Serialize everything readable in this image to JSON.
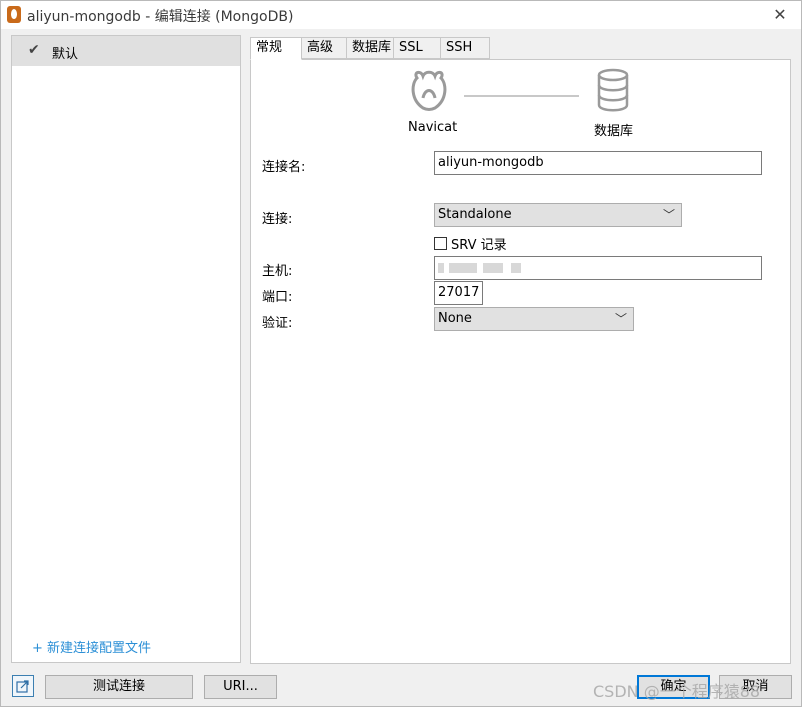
{
  "window": {
    "title": "aliyun-mongodb - 编辑连接 (MongoDB)"
  },
  "profiles": {
    "items": [
      {
        "label": "默认",
        "selected": true
      }
    ],
    "new_profile_label": "+ 新建连接配置文件"
  },
  "tabs": [
    {
      "label": "常规",
      "active": true
    },
    {
      "label": "高级",
      "active": false
    },
    {
      "label": "数据库",
      "active": false
    },
    {
      "label": "SSL",
      "active": false
    },
    {
      "label": "SSH",
      "active": false
    }
  ],
  "diagram": {
    "left_label": "Navicat",
    "right_label": "数据库"
  },
  "form": {
    "connection_name": {
      "label": "连接名:",
      "value": "aliyun-mongodb"
    },
    "connection_type": {
      "label": "连接:",
      "value": "Standalone"
    },
    "srv": {
      "label": "SRV 记录",
      "checked": false
    },
    "host": {
      "label": "主机:",
      "value": ""
    },
    "port": {
      "label": "端口:",
      "value": "27017"
    },
    "auth": {
      "label": "验证:",
      "value": "None"
    }
  },
  "buttons": {
    "test_connection": "测试连接",
    "uri": "URI...",
    "ok": "确定",
    "cancel": "取消"
  },
  "watermark": "CSDN @一个程序猿88",
  "colors": {
    "accent": "#0078d7",
    "link": "#2b8fd6",
    "app_icon": "#c96a1a"
  }
}
